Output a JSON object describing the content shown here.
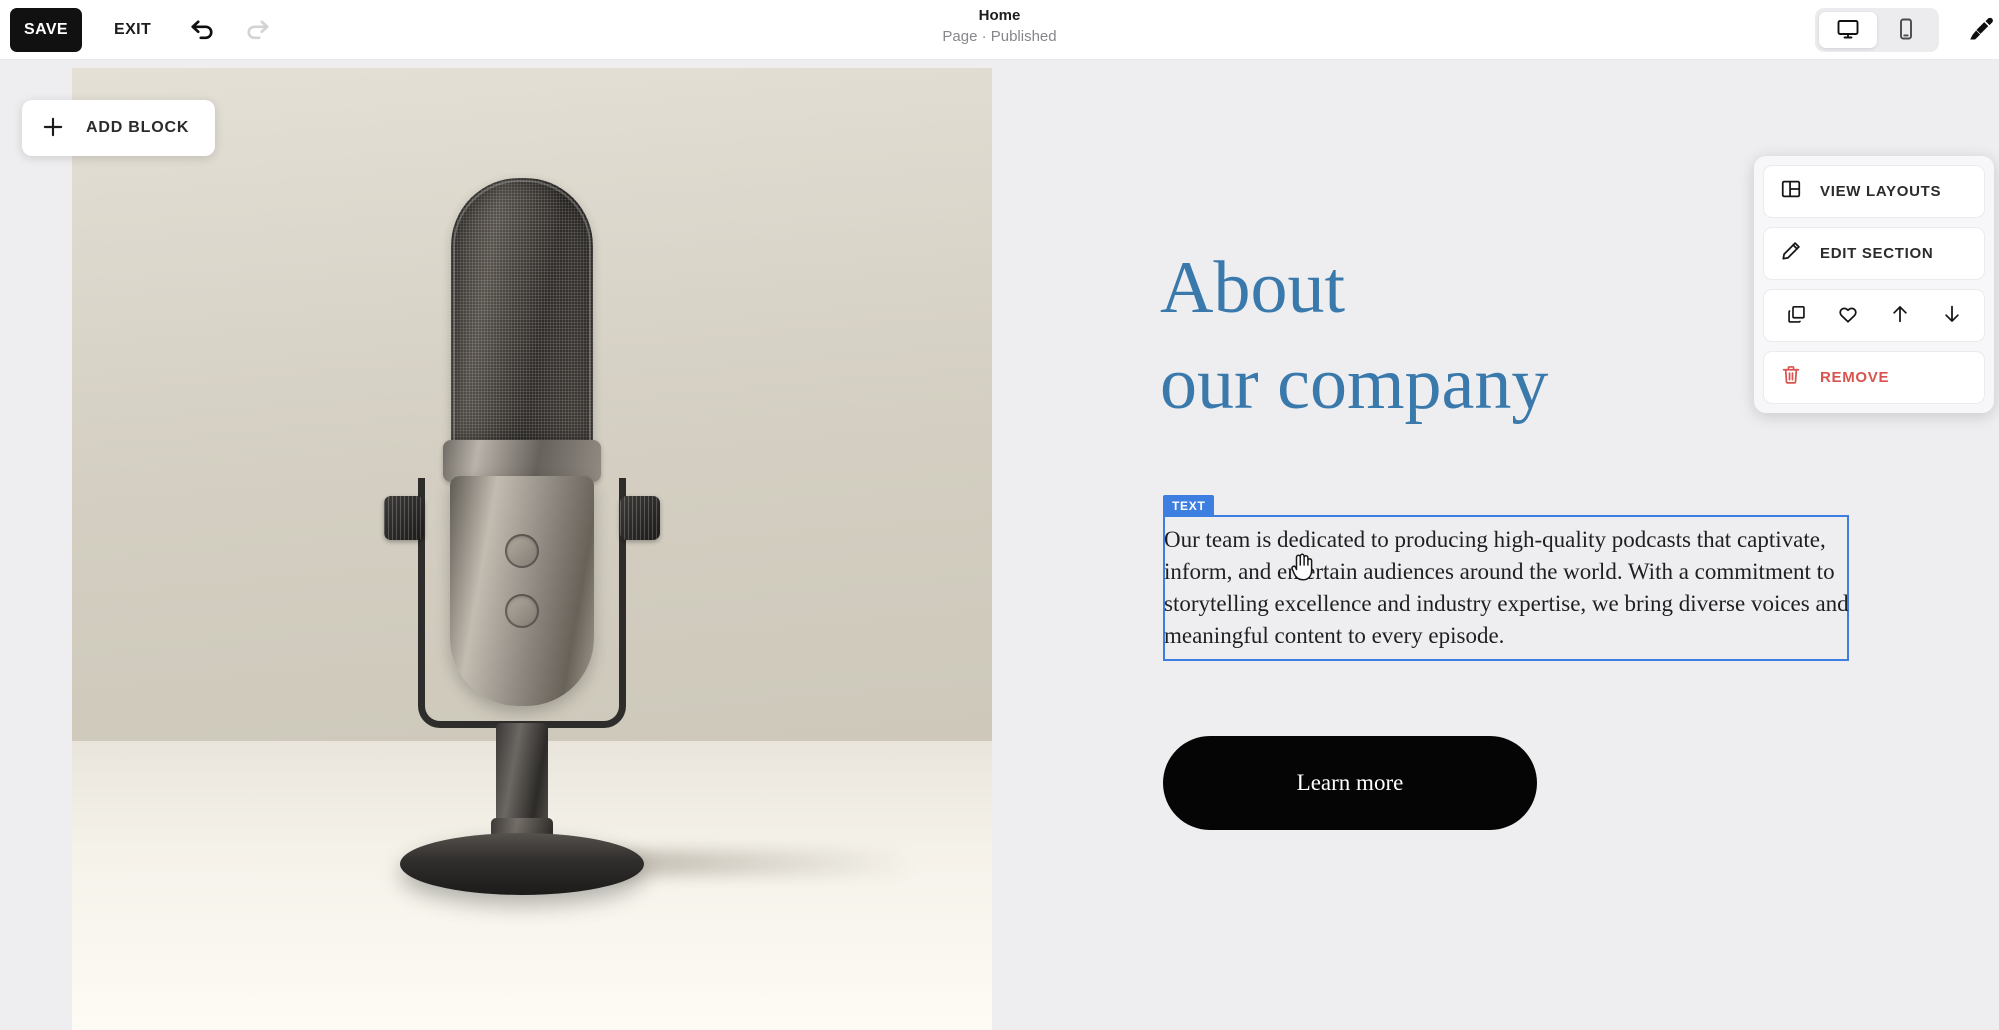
{
  "toolbar": {
    "save_label": "SAVE",
    "exit_label": "EXIT",
    "undo_icon": "undo-arrow-icon",
    "redo_icon": "redo-arrow-icon",
    "desktop_icon": "desktop-monitor-icon",
    "mobile_icon": "mobile-phone-icon",
    "brush_icon": "paintbrush-icon",
    "active_device": "desktop"
  },
  "page": {
    "title": "Home",
    "status": "Page · Published"
  },
  "canvas": {
    "add_block_label": "ADD BLOCK",
    "add_block_icon": "plus-icon",
    "image_alt": "studio-microphone-photo"
  },
  "section": {
    "heading_line1": "About",
    "heading_line2": "our company",
    "heading_color": "#3a79ab",
    "selected_block_badge": "TEXT",
    "body_text": "Our team is dedicated to producing high-quality podcasts that captivate, inform, and entertain audiences around the world. With a commitment to storytelling excellence and industry expertise, we bring diverse voices and meaningful content to every episode.",
    "cta_label": "Learn more",
    "selection_color": "#3d7fe0"
  },
  "section_panel": {
    "view_layouts_label": "VIEW LAYOUTS",
    "view_layouts_icon": "layout-grid-icon",
    "edit_section_label": "EDIT SECTION",
    "edit_section_icon": "pencil-icon",
    "duplicate_icon": "duplicate-icon",
    "favorite_icon": "heart-icon",
    "move_up_icon": "arrow-up-icon",
    "move_down_icon": "arrow-down-icon",
    "remove_label": "REMOVE",
    "remove_icon": "trash-icon",
    "remove_color": "#d9534f"
  },
  "cursor": {
    "type": "pointing-hand-cursor"
  }
}
